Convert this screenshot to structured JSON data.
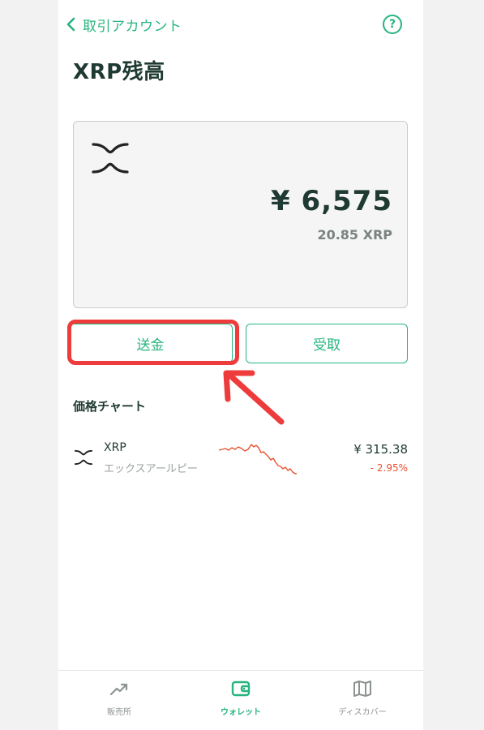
{
  "header": {
    "back_label": "取引アカウント",
    "help_label": "?"
  },
  "page_title": "XRP残高",
  "balance": {
    "fiat_amount": "¥ 6,575",
    "crypto_amount": "20.85 XRP"
  },
  "actions": {
    "send_label": "送金",
    "receive_label": "受取"
  },
  "price_chart": {
    "section_title": "価格チャート",
    "items": [
      {
        "symbol": "XRP",
        "name": "エックスアールピー",
        "price": "¥ 315.38",
        "change": "- 2.95%"
      }
    ]
  },
  "tabbar": {
    "items": [
      {
        "label": "販売所",
        "icon": "trending-up-icon"
      },
      {
        "label": "ウォレット",
        "icon": "wallet-icon"
      },
      {
        "label": "ディスカバー",
        "icon": "map-icon"
      }
    ]
  },
  "colors": {
    "accent": "#27b47e",
    "highlight": "#ee3b3b",
    "negative": "#e8502e"
  }
}
